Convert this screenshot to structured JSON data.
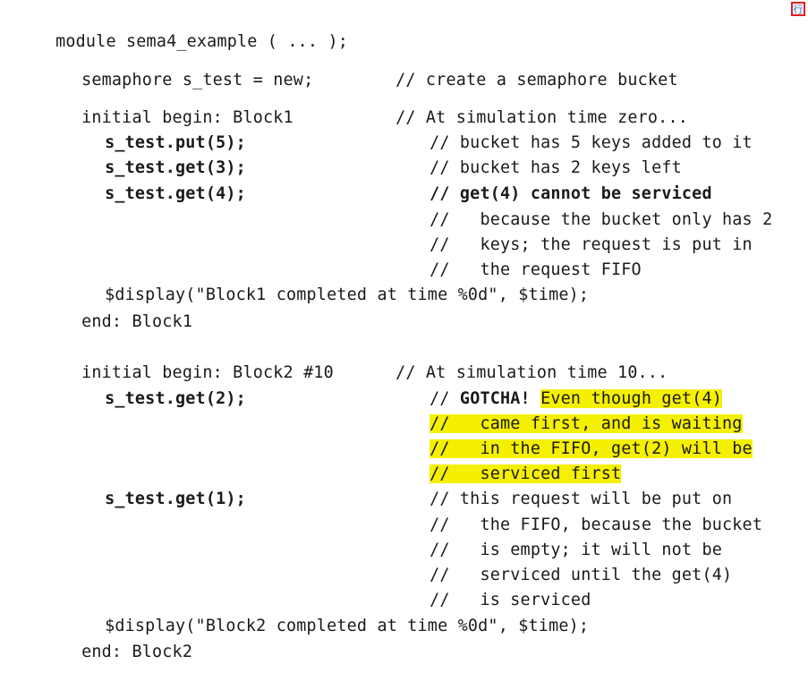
{
  "corner_mark": "行",
  "code": {
    "header": "module sema4_example ( ... );",
    "decl": {
      "code": "semaphore s_test = new;",
      "comment": "// create a semaphore bucket"
    },
    "block1": {
      "begin_code": "initial begin: Block1",
      "begin_comment": "// At simulation time zero...",
      "put5_code": "s_test.put(5);",
      "put5_comment": "// bucket has 5 keys added to it",
      "get3_code": "s_test.get(3);",
      "get3_comment": "// bucket has 2 keys left",
      "get4_code": "s_test.get(4);",
      "get4_comment": "// get(4) cannot be serviced",
      "cont1_slashes": "//",
      "cont1_text": "because the bucket only has 2",
      "cont2_slashes": "//",
      "cont2_text": "keys; the request is put in",
      "cont3_slashes": "//",
      "cont3_text": "the request FIFO",
      "display": "$display(\"Block1 completed at time %0d\", $time);",
      "end": "end: Block1"
    },
    "block2": {
      "begin_code": "initial begin: Block2 #10",
      "begin_comment": "// At simulation time 10...",
      "get2_code": "s_test.get(2);",
      "gotcha_slashes": "//",
      "gotcha_word": "GOTCHA!",
      "gotcha_text": "Even though get(4)",
      "hl1_slashes": "//",
      "hl1_text": "came first, and is waiting",
      "hl2_slashes": "//",
      "hl2_text": "in the FIFO, get(2) will be",
      "hl3_slashes": "//",
      "hl3_text": "serviced first",
      "get1_code": "s_test.get(1);",
      "get1_comment": "// this request will be put on",
      "c1_slashes": "//",
      "c1_text": "the FIFO, because the bucket",
      "c2_slashes": "//",
      "c2_text": "is empty; it will not be",
      "c3_slashes": "//",
      "c3_text": "serviced until the get(4)",
      "c4_slashes": "//",
      "c4_text": "is serviced",
      "display": "$display(\"Block2 completed at time %0d\", $time);",
      "end": "end: Block2"
    }
  }
}
